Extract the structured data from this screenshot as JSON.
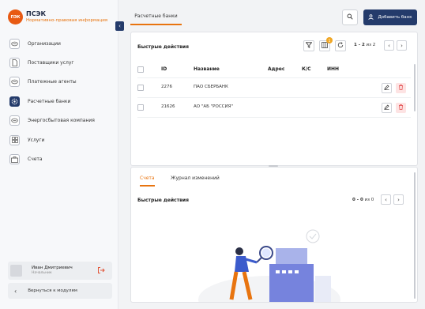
{
  "brand": {
    "logo_text": "ПЭК",
    "name": "ПСЭК",
    "subtitle": "Нормативно-правовая информация"
  },
  "sidebar": {
    "collapse_icon": "chevron-left-icon",
    "items": [
      {
        "label": "Организации",
        "icon": "handshake-icon",
        "active": false
      },
      {
        "label": "Поставщики услуг",
        "icon": "document-icon",
        "active": false
      },
      {
        "label": "Платежные агенты",
        "icon": "handshake-icon",
        "active": false
      },
      {
        "label": "Расчетные банки",
        "icon": "gear-icon",
        "active": true
      },
      {
        "label": "Энергосбытовая компания",
        "icon": "handshake-icon",
        "active": false
      },
      {
        "label": "Услуги",
        "icon": "grid-icon",
        "active": false
      },
      {
        "label": "Счета",
        "icon": "briefcase-icon",
        "active": false
      }
    ],
    "user": {
      "name": "Иван Дмитриевич",
      "role": "Начальник"
    },
    "back_label": "Вернуться к модулям"
  },
  "header": {
    "tab_label": "Расчетные банки",
    "add_button_label": "Добавить банк"
  },
  "top_panel": {
    "quick_actions_label": "Быстрые действия",
    "filter_badge": "5",
    "pager": {
      "range": "1 - 2",
      "of_label": "из 2"
    },
    "columns": [
      "ID",
      "Название",
      "Адрес",
      "К/С",
      "ИНН"
    ],
    "rows": [
      {
        "id": "2276",
        "name": "ПАО СБЕРБАНК",
        "address": "",
        "ks": "",
        "inn": ""
      },
      {
        "id": "21626",
        "name": "АО \"АБ \"РОССИЯ\"",
        "address": "",
        "ks": "",
        "inn": ""
      }
    ]
  },
  "bottom_panel": {
    "tabs": [
      "Счета",
      "Журнал изменений"
    ],
    "active_tab": 0,
    "quick_actions_label": "Быстрые действия",
    "pager": {
      "range": "0 - 0",
      "of_label": "из 0"
    }
  },
  "colors": {
    "accent": "#e8740f",
    "primary": "#243b6b",
    "danger": "#e24848"
  }
}
